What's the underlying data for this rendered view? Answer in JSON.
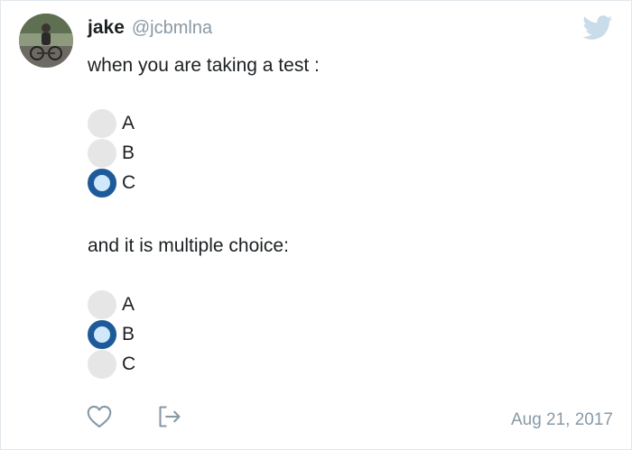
{
  "author": {
    "display_name": "jake",
    "handle": "@jcbmlna"
  },
  "tweet": {
    "line1": "when you are taking a test :",
    "poll1": [
      {
        "label": "A",
        "selected": false
      },
      {
        "label": "B",
        "selected": false
      },
      {
        "label": "C",
        "selected": true
      }
    ],
    "line2": "and it is multiple choice:",
    "poll2": [
      {
        "label": "A",
        "selected": false
      },
      {
        "label": "B",
        "selected": true
      },
      {
        "label": "C",
        "selected": false
      }
    ]
  },
  "footer": {
    "timestamp": "Aug 21, 2017"
  },
  "icons": {
    "like": "heart-icon",
    "share": "share-icon",
    "brand": "twitter-bird-icon"
  },
  "colors": {
    "radio_selected_ring": "#1d5a99",
    "radio_selected_fill": "#cfe9fb",
    "radio_unselected": "#e6e6e6",
    "muted_text": "#8899a6",
    "twitter_logo": "#c9dcea"
  }
}
